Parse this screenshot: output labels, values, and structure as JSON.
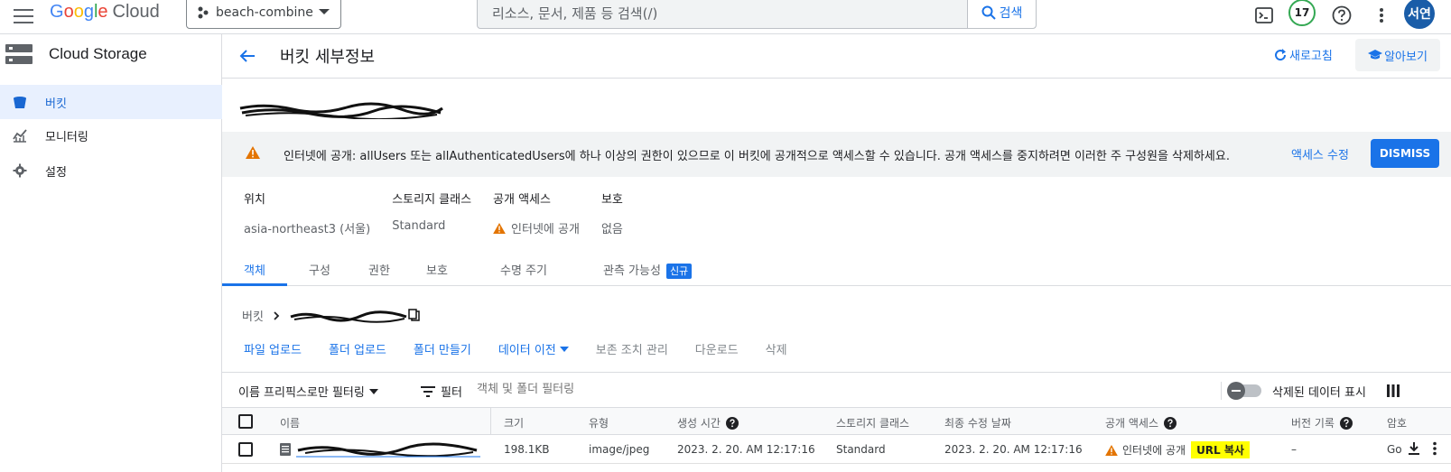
{
  "topbar": {
    "logo_letters": [
      "G",
      "o",
      "o",
      "g",
      "l",
      "e"
    ],
    "logo_product": "Cloud",
    "project_name": "beach-combine",
    "search_placeholder": "리소스, 문서, 제품 등 검색(/)",
    "search_button": "검색",
    "notification_count": "17",
    "avatar_initials": "서연"
  },
  "sidebar": {
    "title": "Cloud Storage",
    "items": [
      {
        "label": "버킷",
        "icon": "bucket-icon",
        "active": true
      },
      {
        "label": "모니터링",
        "icon": "monitoring-icon",
        "active": false
      },
      {
        "label": "설정",
        "icon": "settings-icon",
        "active": false
      }
    ]
  },
  "header": {
    "title": "버킷 세부정보",
    "refresh": "새로고침",
    "learn": "알아보기"
  },
  "banner": {
    "text": "인터넷에 공개: allUsers 또는 allAuthenticatedUsers에 하나 이상의 권한이 있으므로 이 버킷에 공개적으로 액세스할 수 있습니다. 공개 액세스를 중지하려면 이러한 주 구성원을 삭제하세요.",
    "edit_access": "액세스 수정",
    "dismiss": "DISMISS"
  },
  "properties": [
    {
      "key": "위치",
      "value": "asia-northeast3 (서울)"
    },
    {
      "key": "스토리지 클래스",
      "value": "Standard"
    },
    {
      "key": "공개 액세스",
      "value": "인터넷에 공개"
    },
    {
      "key": "보호",
      "value": "없음"
    }
  ],
  "tabs": [
    "객체",
    "구성",
    "권한",
    "보호",
    "수명 주기",
    "관측 가능성"
  ],
  "tab_new_badge": "신규",
  "breadcrumb": {
    "root": "버킷"
  },
  "actions": [
    "파일 업로드",
    "폴더 업로드",
    "폴더 만들기",
    "데이터 이전",
    "보존 조치 관리",
    "다운로드",
    "삭제"
  ],
  "filter": {
    "prefix_label": "이름 프리픽스로만 필터링",
    "filter_label": "필터",
    "placeholder": "객체 및 폴더 필터링",
    "show_deleted": "삭제된 데이터 표시"
  },
  "table": {
    "columns": [
      "이름",
      "크기",
      "유형",
      "생성 시간",
      "스토리지 클래스",
      "최종 수정 날짜",
      "공개 액세스",
      "버전 기록",
      "암호"
    ],
    "rows": [
      {
        "size": "198.1KB",
        "type": "image/jpeg",
        "created": "2023. 2. 20. AM 12:17:16",
        "storage_class": "Standard",
        "modified": "2023. 2. 20. AM 12:17:16",
        "public_access": "인터넷에 공개",
        "copy_url": "URL 복사",
        "version": "–",
        "encryption": "Go"
      }
    ]
  },
  "colors": {
    "accent": "#1a73e8",
    "warning": "#e37400",
    "highlight": "#ffff00"
  }
}
